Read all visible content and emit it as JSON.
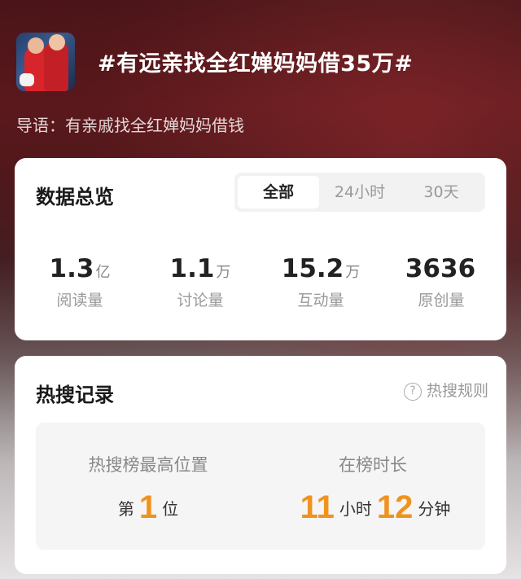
{
  "header": {
    "title": "#有远亲找全红婵妈妈借35万#",
    "lead": "导语：有亲戚找全红婵妈妈借钱"
  },
  "overview": {
    "title": "数据总览",
    "tabs": [
      "全部",
      "24小时",
      "30天"
    ],
    "active_tab": 0,
    "stats": [
      {
        "value": "1.3",
        "unit": "亿",
        "label": "阅读量"
      },
      {
        "value": "1.1",
        "unit": "万",
        "label": "讨论量"
      },
      {
        "value": "15.2",
        "unit": "万",
        "label": "互动量"
      },
      {
        "value": "3636",
        "unit": "",
        "label": "原创量"
      }
    ]
  },
  "hot": {
    "title": "热搜记录",
    "rules_label": "热搜规则",
    "rules_icon": "question-circle-icon",
    "highest_label": "热搜榜最高位置",
    "rank_prefix": "第",
    "rank_value": "1",
    "rank_suffix": "位",
    "duration_label": "在榜时长",
    "hours_value": "11",
    "hours_unit": "小时",
    "minutes_value": "12",
    "minutes_unit": "分钟"
  },
  "colors": {
    "accent": "#f0931e"
  }
}
